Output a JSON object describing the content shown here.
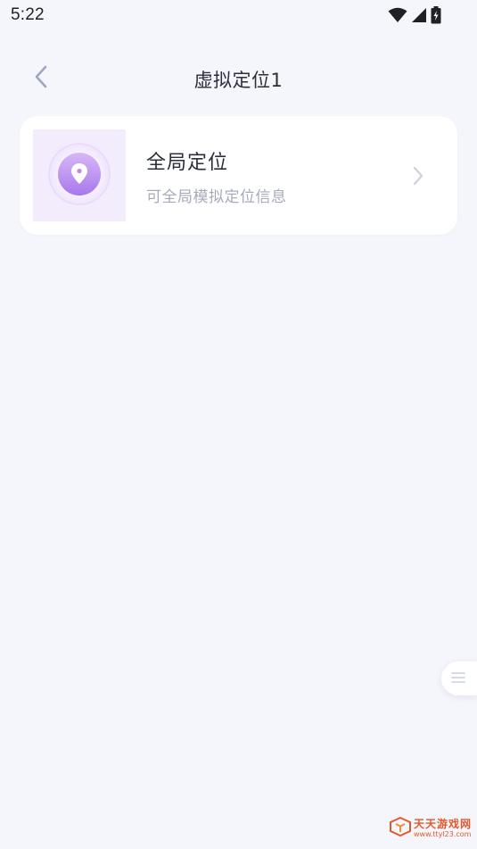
{
  "status_bar": {
    "time": "5:22",
    "icons": [
      "wifi-icon",
      "cell-signal-icon",
      "battery-charging-icon"
    ]
  },
  "header": {
    "title": "虚拟定位1",
    "back_icon": "chevron-left-icon"
  },
  "card": {
    "title": "全局定位",
    "subtitle": "可全局模拟定位信息",
    "thumb_icon": "location-pin-icon",
    "chevron_icon": "chevron-right-icon"
  },
  "float_button": {
    "icon": "menu-lines-icon"
  },
  "watermark": {
    "text": "天天游戏网",
    "url": "www.ttyl23.com"
  },
  "colors": {
    "background": "#f5f6fb",
    "card": "#ffffff",
    "accent_purple": "#b58cf0",
    "thumb_bg": "#f3ecfd",
    "subtitle": "#a7abbb",
    "watermark": "#e2592b"
  }
}
